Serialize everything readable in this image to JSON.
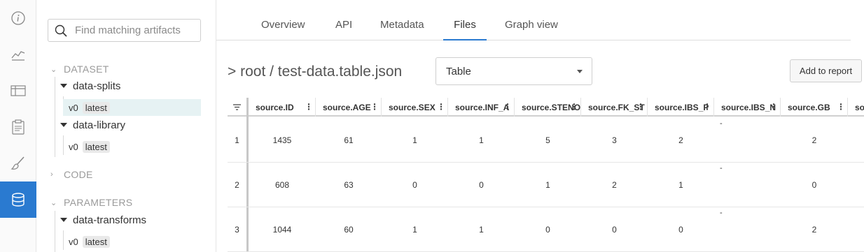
{
  "sidebar": {
    "search_placeholder": "Find matching artifacts",
    "sections": [
      {
        "title": "DATASET",
        "expanded": true,
        "groups": [
          {
            "name": "data-splits",
            "versions": [
              {
                "version": "v0",
                "alias": "latest",
                "selected": true
              }
            ]
          },
          {
            "name": "data-library",
            "versions": [
              {
                "version": "v0",
                "alias": "latest",
                "selected": false
              }
            ]
          }
        ]
      },
      {
        "title": "CODE",
        "expanded": false,
        "groups": []
      },
      {
        "title": "PARAMETERS",
        "expanded": true,
        "groups": [
          {
            "name": "data-transforms",
            "versions": [
              {
                "version": "v0",
                "alias": "latest",
                "selected": false
              }
            ]
          }
        ]
      }
    ]
  },
  "rail": {
    "items": [
      "info-icon",
      "chart-line-icon",
      "table-icon",
      "clipboard-icon",
      "brush-icon",
      "database-icon"
    ],
    "active": "database-icon",
    "active_color": "#2a7ad0"
  },
  "tabs": {
    "items": [
      "Overview",
      "API",
      "Metadata",
      "Files",
      "Graph view"
    ],
    "active": "Files"
  },
  "file_view": {
    "path": "> root / test-data.table.json",
    "view_select": "Table",
    "add_to_report": "Add to report"
  },
  "table": {
    "columns": [
      "source.ID",
      "source.AGE",
      "source.SEX",
      "source.INF_A",
      "source.STENO",
      "source.FK_ST",
      "source.IBS_P",
      "source.IBS_N",
      "source.GB",
      "sou"
    ],
    "rows": [
      {
        "num": "1",
        "cells": [
          "1435",
          "61",
          "1",
          "1",
          "5",
          "3",
          "2",
          "-",
          "2",
          ""
        ]
      },
      {
        "num": "2",
        "cells": [
          "608",
          "63",
          "0",
          "0",
          "1",
          "2",
          "1",
          "-",
          "0",
          ""
        ]
      },
      {
        "num": "3",
        "cells": [
          "1044",
          "60",
          "1",
          "1",
          "0",
          "0",
          "0",
          "-",
          "2",
          ""
        ]
      }
    ]
  },
  "colors": {
    "accent": "#2a7ad0",
    "selected_row": "#e6f2f3"
  }
}
